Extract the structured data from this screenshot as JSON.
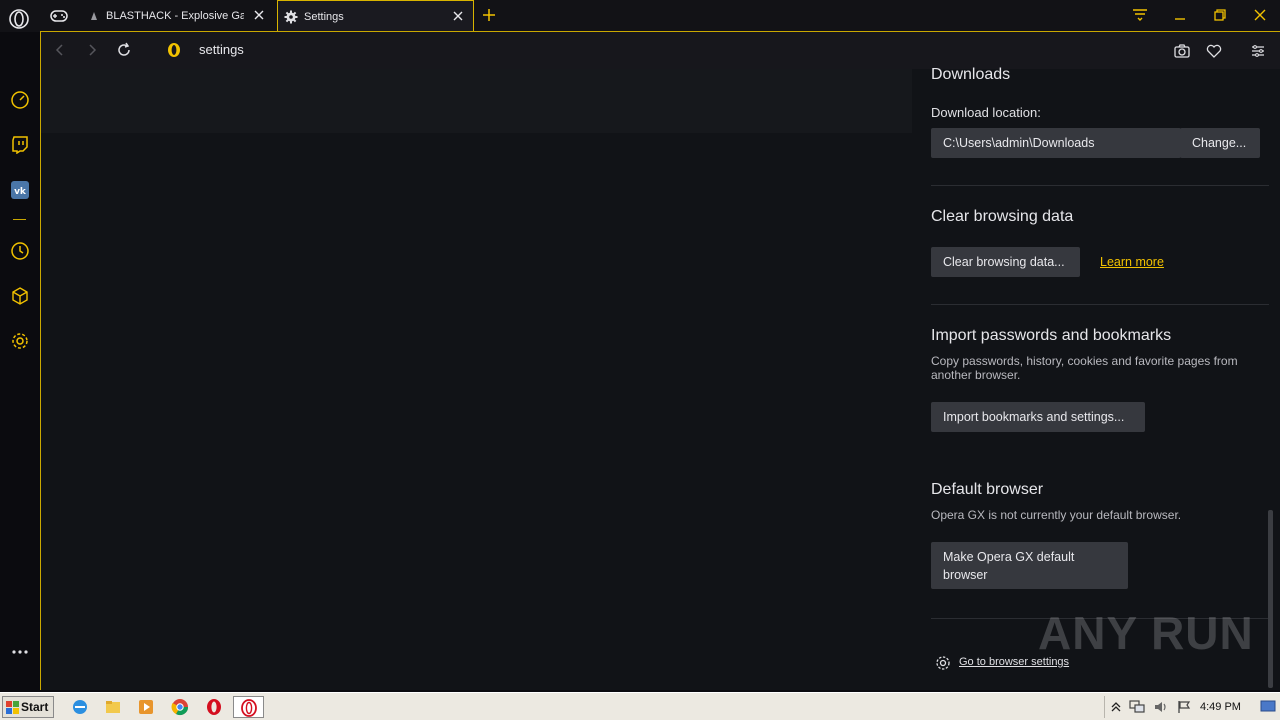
{
  "tabs": [
    {
      "title": "BLASTHACK - Explosive Game Hacking"
    },
    {
      "title": "Settings"
    }
  ],
  "address": {
    "text": "settings"
  },
  "sidebar": {
    "icons": [
      "speed-dial-icon",
      "twitch-icon",
      "vk-icon",
      "history-icon",
      "extensions-icon",
      "settings-icon",
      "more-icon"
    ]
  },
  "settings": {
    "downloads": {
      "title": "Downloads",
      "location_label": "Download location:",
      "location_value": "C:\\Users\\admin\\Downloads",
      "change_button": "Change..."
    },
    "clear": {
      "title": "Clear browsing data",
      "button": "Clear browsing data...",
      "learn_more": "Learn more"
    },
    "import": {
      "title": "Import passwords and bookmarks",
      "description": "Copy passwords, history, cookies and favorite pages from another browser.",
      "button": "Import bookmarks and settings..."
    },
    "default_browser": {
      "title": "Default browser",
      "description": "Opera GX is not currently your default browser.",
      "button": "Make Opera GX default browser"
    },
    "goto_browser_settings": "Go to browser settings"
  },
  "watermark": "ANY RUN",
  "taskbar": {
    "start_label": "Start",
    "clock": "4:49 PM"
  },
  "colors": {
    "accent": "#f2c200",
    "frame": "#c9a800",
    "background": "#111317"
  }
}
